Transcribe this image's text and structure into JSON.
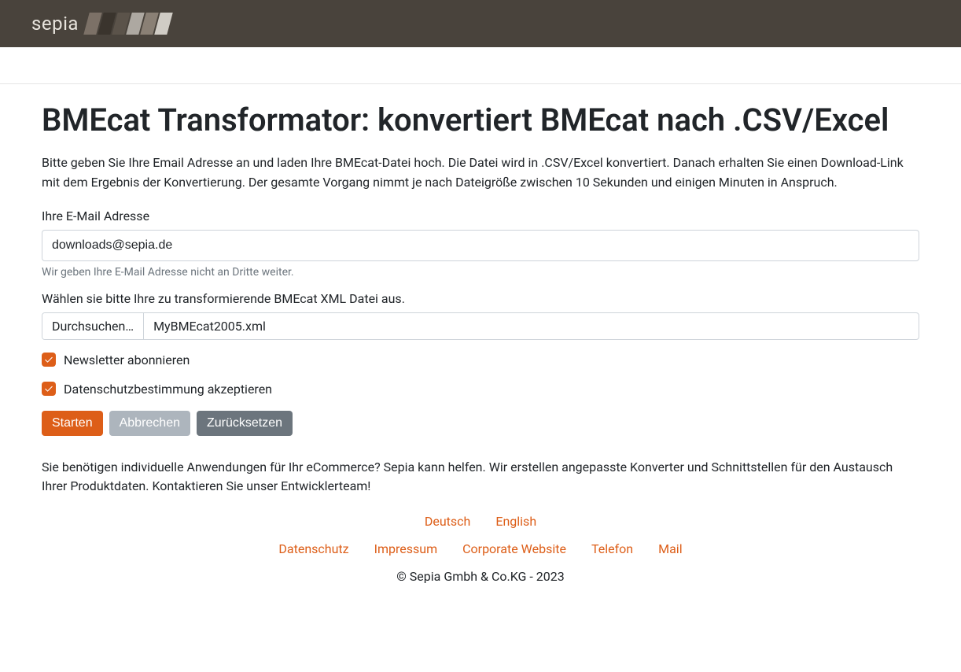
{
  "brand": "sepia",
  "page": {
    "title": "BMEcat Transformator: konvertiert BMEcat nach .CSV/Excel",
    "intro": "Bitte geben Sie Ihre Email Adresse an und laden Ihre BMEcat-Datei hoch. Die Datei wird in .CSV/Excel konvertiert. Danach erhalten Sie einen Download-Link mit dem Ergebnis der Konvertierung. Der gesamte Vorgang nimmt je nach Dateigröße zwischen 10 Sekunden und einigen Minuten in Anspruch.",
    "outro": "Sie benötigen individuelle Anwendungen für Ihr eCommerce? Sepia kann helfen. Wir erstellen angepasste Konverter und Schnittstellen für den Austausch Ihrer Produktdaten. Kontaktieren Sie unser Entwicklerteam!"
  },
  "form": {
    "email": {
      "label": "Ihre E-Mail Adresse",
      "value": "downloads@sepia.de",
      "help": "Wir geben Ihre E-Mail Adresse nicht an Dritte weiter."
    },
    "file": {
      "label": "Wählen sie bitte Ihre zu transformierende BMEcat XML Datei aus.",
      "browse": "Durchsuchen…",
      "filename": "MyBMEcat2005.xml"
    },
    "newsletter": {
      "label": "Newsletter abonnieren",
      "checked": true
    },
    "privacy": {
      "label": "Datenschutzbestimmung akzeptieren",
      "checked": true
    },
    "buttons": {
      "start": "Starten",
      "cancel": "Abbrechen",
      "reset": "Zurücksetzen"
    }
  },
  "langs": {
    "de": "Deutsch",
    "en": "English"
  },
  "footer": {
    "links": {
      "privacy": "Datenschutz",
      "imprint": "Impressum",
      "corporate": "Corporate Website",
      "phone": "Telefon",
      "mail": "Mail"
    },
    "copyright": "© Sepia Gmbh & Co.KG - 2023"
  }
}
